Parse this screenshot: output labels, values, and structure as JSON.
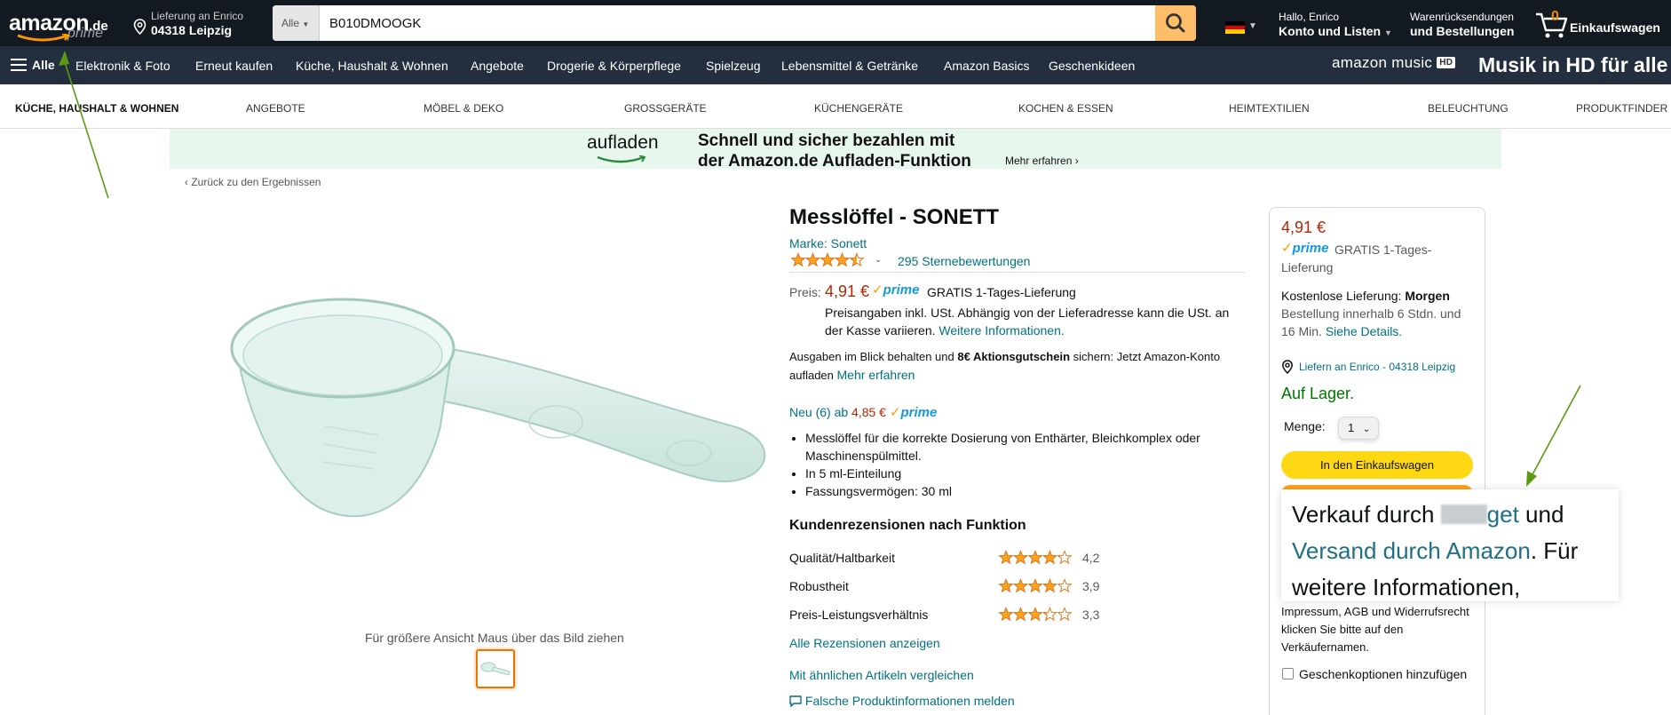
{
  "header": {
    "logo_word": "amazon",
    "logo_tld": ".de",
    "logo_prime": "prime",
    "deliver_line1": "Lieferung an Enrico",
    "deliver_line2": "04318 Leipzig",
    "search_category": "Alle",
    "search_value": "B010DMOOGK",
    "account_line1": "Hallo, Enrico",
    "account_line2": "Konto und Listen",
    "orders_line1": "Warenrücksendungen",
    "orders_line2": "und Bestellungen",
    "cart_count": "0",
    "cart_label": "Einkaufswagen"
  },
  "nav": {
    "all_label": "Alle",
    "items": [
      "Elektronik & Foto",
      "Erneut kaufen",
      "Küche, Haushalt & Wohnen",
      "Angebote",
      "Drogerie & Körperpflege",
      "Spielzeug",
      "Lebensmittel & Getränke",
      "Amazon Basics",
      "Geschenkideen"
    ],
    "music_logo": "amazon music",
    "music_hd": "HD",
    "music_promo": "Musik in HD für alle"
  },
  "subnav": {
    "items": [
      "Küche, Haushalt & Wohnen",
      "Angebote",
      "Möbel & Deko",
      "Großgeräte",
      "Küchengeräte",
      "Kochen & Essen",
      "Heimtextilien",
      "Beleuchtung",
      "Produktfinder"
    ]
  },
  "banner": {
    "brand": "aufladen",
    "text_line1": "Schnell und sicher bezahlen mit",
    "text_line2": "der Amazon.de Aufladen-Funktion",
    "more": "Mehr erfahren ›"
  },
  "back_link": "‹ Zurück zu den Ergebnissen",
  "image_hint": "Für größere Ansicht Maus über das Bild ziehen",
  "product": {
    "title": "Messlöffel - SONETT",
    "brand_link": "Marke: Sonett",
    "rating": 4.5,
    "rating_count": "295 Sternebewertungen",
    "price_label": "Preis:",
    "price": "4,91 €",
    "prime_label": "prime",
    "free_delivery": "GRATIS 1-Tages-Lieferung",
    "tax_text": "Preisangaben inkl. USt. Abhängig von der Lieferadresse kann die USt. an der Kasse variieren.",
    "tax_link": "Weitere Informationen.",
    "promo_pre": "Ausgaben im Blick behalten und ",
    "promo_bold": "8€ Aktionsgutschein",
    "promo_post": " sichern: Jetzt Amazon-Konto aufladen ",
    "promo_link": "Mehr erfahren",
    "new_offers": "Neu (6) ab ",
    "new_offers_price": "4,85 €",
    "bullets": [
      "Messlöffel für die korrekte Dosierung von Enthärter, Bleichkomplex oder Maschinenspülmittel.",
      "In 5 ml-Einteilung",
      "Fassungsvermögen: 30 ml"
    ],
    "reviews_heading": "Kundenrezensionen nach Funktion",
    "features": [
      {
        "name": "Qualität/Haltbarkeit",
        "rating": 4.2,
        "value": "4,2"
      },
      {
        "name": "Robustheit",
        "rating": 3.9,
        "value": "3,9"
      },
      {
        "name": "Preis-Leistungsverhältnis",
        "rating": 3.3,
        "value": "3,3"
      }
    ],
    "all_reviews": "Alle Rezensionen anzeigen",
    "compare": "Mit ähnlichen Artikeln vergleichen",
    "report": "Falsche Produktinformationen melden"
  },
  "buybox": {
    "price": "4,91 €",
    "prime_label": "prime",
    "free_delivery": "GRATIS 1-Tages-Lieferung",
    "delivery_lead": "Kostenlose Lieferung: ",
    "delivery_day": "Morgen",
    "delivery_order": "Bestellung innerhalb 6 Stdn. und 16 Min. ",
    "delivery_link": "Siehe Details.",
    "location": "Liefern an Enrico - 04318 Leipzig",
    "stock": "Auf Lager.",
    "qty_label": "Menge:",
    "qty_value": "1",
    "add_to_cart": "In den Einkaufswagen",
    "legal": "Impressum, AGB und Widerrufsrecht klicken Sie bitte auf den Verkäufernamen.",
    "gift": "Geschenkoptionen hinzufügen"
  },
  "zoom": {
    "line1_pre": "Verkauf durch ",
    "line1_link": "get",
    "line1_post": " und",
    "line2_link": "Versand durch Amazon",
    "line2_post": ". Für",
    "line3": "weitere Informationen,"
  },
  "colors": {
    "nav_dark": "#131921",
    "nav_main": "#232f3e",
    "price_red": "#b12704",
    "link_teal": "#007185",
    "stock_green": "#007600",
    "cart_yellow": "#ffd814",
    "star_orange": "#ffa41c",
    "arrow_green": "#5a9a13"
  }
}
